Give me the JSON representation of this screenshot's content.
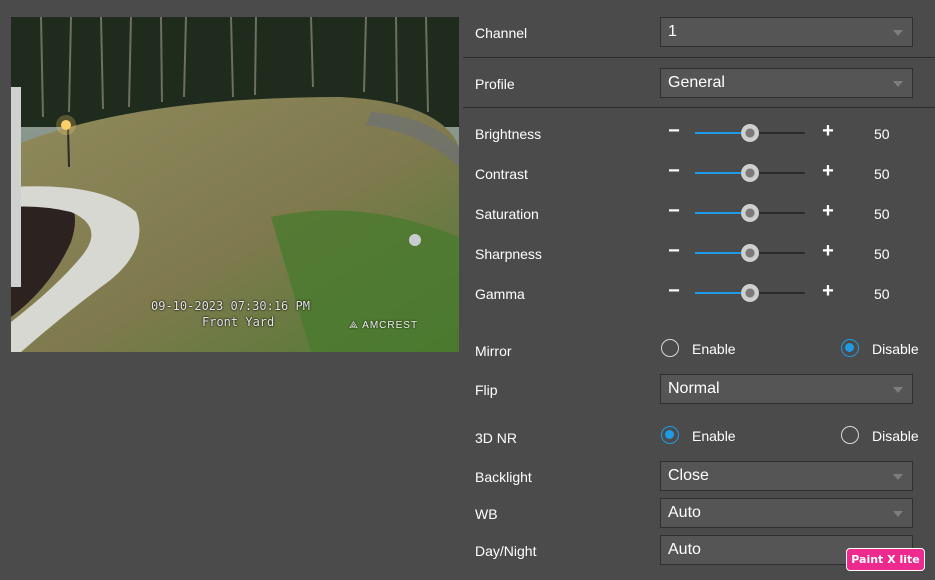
{
  "preview": {
    "timestamp": "09-10-2023 07:30:16 PM",
    "camera_name": "Front Yard",
    "logo": "AMCREST"
  },
  "settings": {
    "channel": {
      "label": "Channel",
      "value": "1"
    },
    "profile": {
      "label": "Profile",
      "value": "General"
    },
    "sliders": [
      {
        "label": "Brightness",
        "value": 50
      },
      {
        "label": "Contrast",
        "value": 50
      },
      {
        "label": "Saturation",
        "value": 50
      },
      {
        "label": "Sharpness",
        "value": 50
      },
      {
        "label": "Gamma",
        "value": 50
      }
    ],
    "mirror": {
      "label": "Mirror",
      "enable_label": "Enable",
      "disable_label": "Disable",
      "selected": "Disable"
    },
    "flip": {
      "label": "Flip",
      "value": "Normal"
    },
    "nr3d": {
      "label": "3D NR",
      "enable_label": "Enable",
      "disable_label": "Disable",
      "selected": "Enable"
    },
    "backlight": {
      "label": "Backlight",
      "value": "Close"
    },
    "wb": {
      "label": "WB",
      "value": "Auto"
    },
    "daynight": {
      "label": "Day/Night",
      "value": "Auto"
    }
  },
  "badge": {
    "text": "Paint X lite"
  },
  "colors": {
    "accent": "#1e9be2",
    "background": "#4b4b4b",
    "badge": "#ee2a8e"
  }
}
